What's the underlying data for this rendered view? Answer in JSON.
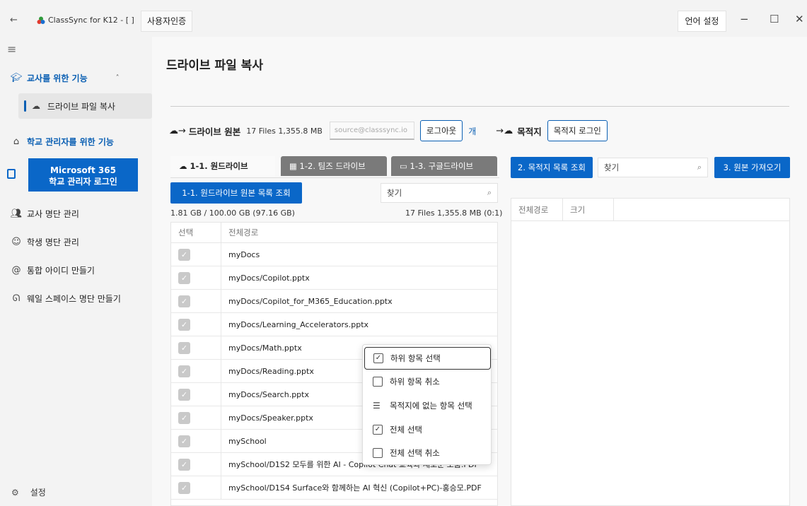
{
  "titlebar": {
    "back_icon": "back-arrow-icon",
    "app_title": "ClassSync for K12 - [ ]",
    "tab_label": "사용자인증",
    "lang_button": "언어 설정",
    "minimize": "−",
    "maximize": "☐",
    "close": "✕"
  },
  "sidebar": {
    "section_teacher": "교사를 위한 기능",
    "item_drive_copy": "드라이브 파일 복사",
    "section_admin": "학교 관리자를 위한 기능",
    "ms_login_line1": "Microsoft 365",
    "ms_login_line2": "학교 관리자 로그인",
    "items": [
      {
        "label": "교사 명단 관리",
        "icon": "people-icon"
      },
      {
        "label": "학생 명단 관리",
        "icon": "student-icon"
      },
      {
        "label": "통합 아이디 만들기",
        "icon": "at-icon"
      },
      {
        "label": "웨일 스페이스 명단 만들기",
        "icon": "whale-icon"
      }
    ],
    "settings": "설정"
  },
  "main": {
    "title": "드라이브 파일 복사",
    "source_label": "드라이브 원본",
    "source_stats": "17 Files 1,355.8 MB",
    "source_email": "source@classsync.io",
    "logout_button": "로그아웃",
    "open_link": "개",
    "dest_label": "목적지",
    "dest_login_button": "목적지 로그인",
    "tabs": [
      {
        "label": "1-1. 원드라이브",
        "icon": "cloud-icon"
      },
      {
        "label": "1-2. 팀즈 드라이브",
        "icon": "teams-icon"
      },
      {
        "label": "1-3. 구글드라이브",
        "icon": "folder-icon"
      }
    ],
    "source_list_button": "1-1. 원드라이브 원본 목록 조회",
    "search_placeholder": "찾기",
    "quota": "1.81 GB / 100.00 GB (97.16 GB)",
    "file_summary": "17 Files 1,355.8 MB (0:1)",
    "columns": {
      "select": "선택",
      "path": "전체경로"
    },
    "rows": [
      "myDocs",
      "myDocs/Copilot.pptx",
      "myDocs/Copilot_for_M365_Education.pptx",
      "myDocs/Learning_Accelerators.pptx",
      "myDocs/Math.pptx",
      "myDocs/Reading.pptx",
      "myDocs/Search.pptx",
      "myDocs/Speaker.pptx",
      "mySchool",
      "mySchool/D1S2 모두를 위한 AI - Copilot Chat 교육과 새로운 도움.PDF",
      "mySchool/D1S4 Surface와 함께하는 AI 혁신 (Copilot+PC)-홍승모.PDF"
    ],
    "dest_list_button": "2. 목적지 목록 조회",
    "dest_search": "찾기",
    "fetch_button": "3. 원본 가져오기",
    "dest_columns": {
      "path": "전체경로",
      "size": "크기"
    }
  },
  "context_menu": {
    "items": [
      {
        "label": "하위 항목 선택",
        "checked": true
      },
      {
        "label": "하위 항목 취소",
        "checked": false
      },
      {
        "label": "목적지에 없는 항목 선택",
        "icon": "list-check-icon"
      },
      {
        "label": "전체 선택",
        "checked": true
      },
      {
        "label": "전체 선택 취소",
        "checked": false
      }
    ]
  },
  "colors": {
    "accent": "#0a67c8",
    "sidebar_bg": "#f3f3f3",
    "tab_dark": "#7a7a7a"
  }
}
